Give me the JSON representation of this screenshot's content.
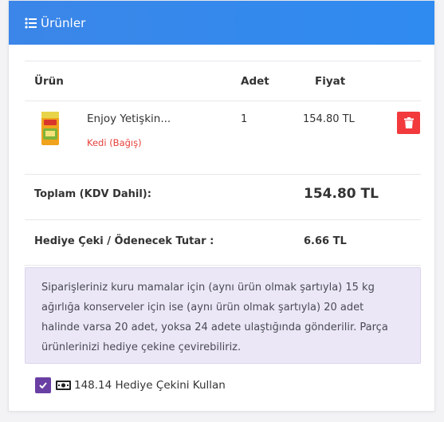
{
  "header": {
    "title": "Ürünler",
    "icon": "list-icon"
  },
  "table": {
    "columns": [
      "Ürün",
      "Adet",
      "Fiyat"
    ],
    "items": [
      {
        "name": "Enjoy Yetişkin...",
        "category": "Kedi (Bağış)",
        "quantity": "1",
        "price": "154.80 TL",
        "image_icon": "product-bag-icon",
        "delete_icon": "trash-icon"
      }
    ]
  },
  "summary": {
    "total_label": "Toplam (KDV Dahil):",
    "total_value": "154.80 TL",
    "gift_label": "Hediye Çeki / Ödenecek Tutar :",
    "gift_value": "6.66 TL"
  },
  "notice": "Siparişleriniz kuru mamalar için (aynı ürün olmak şartıyla) 15 kg ağırlığa konserveler için ise (aynı ürün olmak şartıyla) 20 adet halinde varsa 20 adet, yoksa 24 adete ulaştığında gönderilir. Parça ürünlerinizi hediye çekine çevirebiliriz.",
  "gift_option": {
    "checked": true,
    "label": "148.14 Hediye Çekini Kullan",
    "icon": "money-icon"
  },
  "colors": {
    "header_blue": "#3b86e8",
    "delete_red": "#f2393c",
    "category_red": "#e5413b",
    "notice_bg": "#ebe7f6",
    "checkbox_purple": "#6a3fa3"
  }
}
